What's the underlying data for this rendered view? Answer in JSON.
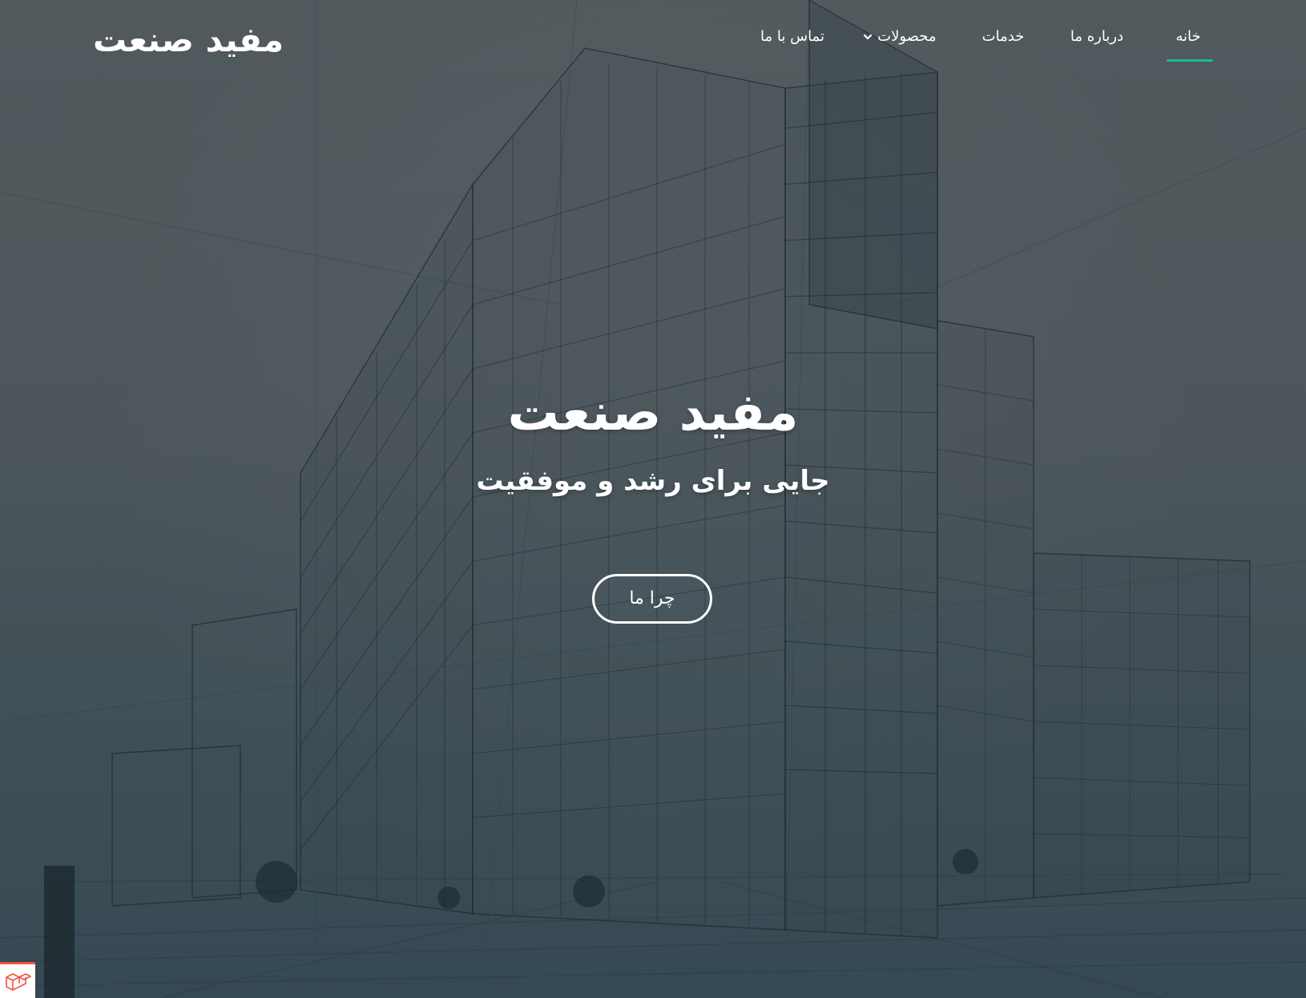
{
  "brand": {
    "name": "مفید صنعت"
  },
  "nav": {
    "items": [
      {
        "label": "خانه",
        "active": true
      },
      {
        "label": "درباره ما",
        "active": false
      },
      {
        "label": "خدمات",
        "active": false
      },
      {
        "label": "محصولات",
        "active": false,
        "icon": "chevron-down-icon"
      },
      {
        "label": "تماس با ما",
        "active": false
      }
    ],
    "accent_color": "#1fb897"
  },
  "hero": {
    "title": "مفید صنعت",
    "subtitle": "جایی برای رشد و موفقیت",
    "cta_label": "چرا  ما",
    "background_icon": "building-wireframe-image"
  },
  "corner_widget": {
    "icon": "laravel-cube-icon",
    "accent_color": "#f05340"
  }
}
